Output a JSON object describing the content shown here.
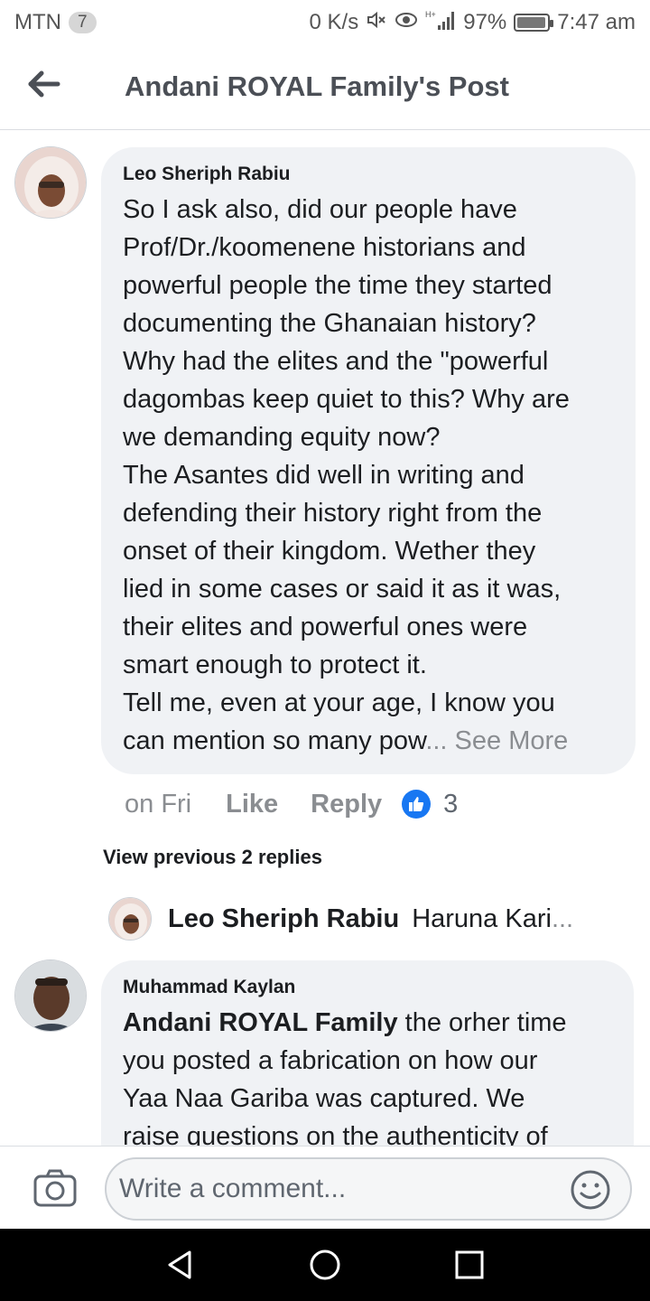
{
  "status_bar": {
    "carrier": "MTN",
    "badge": "7",
    "speed": "0 K/s",
    "signal_label": "H+",
    "battery": "97%",
    "battery_level": 0.97,
    "time": "7:47 am"
  },
  "header": {
    "title": "Andani ROYAL Family's Post"
  },
  "comment1": {
    "author": "Leo Sheriph Rabiu",
    "text": "So I ask also, did our people have\nProf/Dr./koomenene historians and\npowerful people the time they started\ndocumenting the Ghanaian history?\nWhy had the elites and the \"powerful\ndagombas keep quiet to this? Why are\nwe demanding equity now?\nThe Asantes did well in writing and\ndefending their history right from the\nonset of their kingdom. Wether they\nlied in some cases or said it as it was,\ntheir elites and powerful ones were\nsmart enough to protect it.\nTell me, even at your age, I know you\ncan mention so many pow",
    "ellipsis": "...",
    "see_more": " See More",
    "time": "on Fri",
    "like": "Like",
    "reply": "Reply",
    "likes_count": "3"
  },
  "view_previous": "View previous 2 replies",
  "reply_preview": {
    "author": "Leo Sheriph Rabiu",
    "text": "Haruna Kari",
    "ellipsis": "..."
  },
  "comment2": {
    "author": "Muhammad Kaylan",
    "mention": "Andani ROYAL Family",
    "text": "  the orher time\nyou posted a fabrication on how our\nYaa Naa Gariba was captured. We\nraise questions on the authenticity of"
  },
  "composer": {
    "placeholder": "Write a comment..."
  },
  "icons": {
    "back": "back-arrow-icon",
    "camera": "camera-icon",
    "emoji": "emoji-icon",
    "nav_back": "nav-back-icon",
    "nav_home": "nav-home-icon",
    "nav_recents": "nav-recents-icon"
  },
  "colors": {
    "accent": "#1877f2",
    "bubble": "#f0f2f5",
    "muted": "#8a8d91"
  }
}
